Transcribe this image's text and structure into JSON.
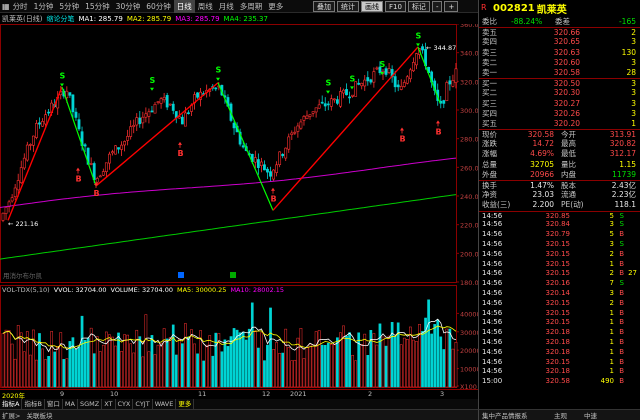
{
  "toolbar": {
    "periods": [
      "分时",
      "1分钟",
      "5分钟",
      "15分钟",
      "30分钟",
      "60分钟",
      "日线",
      "周线",
      "月线",
      "多周期",
      "更多"
    ],
    "active_period": "日线",
    "settings_icon": "gear-icon",
    "right_buttons": [
      "叠加",
      "统计",
      "画线",
      "F10",
      "标记",
      "-",
      "+"
    ],
    "selected_button": "画线"
  },
  "stock": {
    "code": "002821",
    "name": "凯莱英",
    "mark": "R"
  },
  "chart_header": {
    "label": "凯莱英(日线)",
    "fmt": "缩论分笔",
    "ma1": "MA1: 285.79",
    "ma2": "MA2: 285.79",
    "ma3": "MA3: 285.79",
    "ma4": "MA4: 235.37"
  },
  "chart_annotations": {
    "high_label": "344.87",
    "low_label": "221.16",
    "bottom_note": "用消尔布尔凯"
  },
  "y_axis": [
    "360.0",
    "340.0",
    "320.0",
    "300.0",
    "280.0",
    "260.0",
    "240.0",
    "220.0",
    "200.0",
    "180.0"
  ],
  "vol_header": {
    "title": "VOL-TDX(5,10)",
    "vvol": "VVOL: 32704.00",
    "volume": "VOLUME: 32704.00",
    "ma5": "MA5: 30000.25",
    "ma10": "MA10: 28002.15"
  },
  "vol_axis": [
    "40000",
    "30000",
    "20000",
    "10000",
    "X100"
  ],
  "x_axis": [
    "2020年",
    "9",
    "10",
    "11",
    "12",
    "2021",
    "2",
    "3"
  ],
  "index_tabs": [
    "指标A",
    "指标B",
    "窗口",
    "MA",
    "SGMZ",
    "XT",
    "CYX",
    "CYJT",
    "WAVE",
    "更多"
  ],
  "status_bar": {
    "left": "扩展>",
    "mid": "关联板块"
  },
  "right_status": {
    "left": "集中产品情报系",
    "mid": "主观",
    "right": "中速"
  },
  "quote": {
    "wei_bi_label": "委比",
    "wei_bi": "-88.24%",
    "wei_cha_label": "委差",
    "wei_cha": "-165",
    "asks": [
      {
        "label": "卖五",
        "price": "320.66",
        "vol": "2"
      },
      {
        "label": "卖四",
        "price": "320.65",
        "vol": "3"
      },
      {
        "label": "卖三",
        "price": "320.63",
        "vol": "130"
      },
      {
        "label": "卖二",
        "price": "320.60",
        "vol": "3"
      },
      {
        "label": "卖一",
        "price": "320.58",
        "vol": "28"
      }
    ],
    "bids": [
      {
        "label": "买一",
        "price": "320.50",
        "vol": "3"
      },
      {
        "label": "买二",
        "price": "320.30",
        "vol": "3"
      },
      {
        "label": "买三",
        "price": "320.27",
        "vol": "3"
      },
      {
        "label": "买四",
        "price": "320.26",
        "vol": "3"
      },
      {
        "label": "买五",
        "price": "320.20",
        "vol": "1"
      }
    ],
    "stats": [
      {
        "l1": "现价",
        "v1": "320.58",
        "l2": "今开",
        "v2": "313.91"
      },
      {
        "l1": "涨跌",
        "v1": "14.72",
        "l2": "最高",
        "v2": "320.82"
      },
      {
        "l1": "涨幅",
        "v1": "4.69%",
        "l2": "最低",
        "v2": "312.17"
      },
      {
        "l1": "总量",
        "v1": "32705",
        "l2": "量比",
        "v2": "1.15"
      },
      {
        "l1": "外盘",
        "v1": "20966",
        "l2": "内盘",
        "v2": "11739"
      }
    ],
    "stats2": [
      {
        "l1": "换手",
        "v1": "1.47%",
        "l2": "股本",
        "v2": "2.43亿"
      },
      {
        "l1": "净资",
        "v1": "23.03",
        "l2": "流通",
        "v2": "2.23亿"
      },
      {
        "l1": "收益(三)",
        "v1": "2.200",
        "l2": "PE(动)",
        "v2": "118.1"
      }
    ],
    "ticks": [
      {
        "time": "14:56",
        "price": "320.85",
        "vol": "5",
        "dir": "S"
      },
      {
        "time": "14:56",
        "price": "320.84",
        "vol": "3",
        "dir": "S"
      },
      {
        "time": "14:56",
        "price": "320.79",
        "vol": "5",
        "dir": "B"
      },
      {
        "time": "14:56",
        "price": "320.15",
        "vol": "3",
        "dir": "S"
      },
      {
        "time": "14:56",
        "price": "320.15",
        "vol": "2",
        "dir": "B"
      },
      {
        "time": "14:56",
        "price": "320.15",
        "vol": "1",
        "dir": "B"
      },
      {
        "time": "14:56",
        "price": "320.15",
        "vol": "2",
        "dir": "B"
      },
      {
        "time": "14:56",
        "price": "320.16",
        "vol": "7",
        "dir": "S"
      },
      {
        "time": "14:56",
        "price": "320.14",
        "vol": "3",
        "dir": "B"
      },
      {
        "time": "14:56",
        "price": "320.15",
        "vol": "2",
        "dir": "B"
      },
      {
        "time": "14:56",
        "price": "320.15",
        "vol": "1",
        "dir": "B"
      },
      {
        "time": "14:56",
        "price": "320.15",
        "vol": "1",
        "dir": "B"
      },
      {
        "time": "14:56",
        "price": "320.18",
        "vol": "1",
        "dir": "B"
      },
      {
        "time": "14:56",
        "price": "320.18",
        "vol": "1",
        "dir": "B"
      },
      {
        "time": "14:56",
        "price": "320.18",
        "vol": "1",
        "dir": "B"
      },
      {
        "time": "14:56",
        "price": "320.15",
        "vol": "1",
        "dir": "B"
      },
      {
        "time": "14:56",
        "price": "320.18",
        "vol": "1",
        "dir": "B"
      },
      {
        "time": "15:00",
        "price": "320.58",
        "vol": "490",
        "dir": "B"
      }
    ],
    "tick_extra": "27"
  },
  "chart_data": {
    "type": "candlestick",
    "ylim": [
      180,
      360
    ],
    "candles_count": 150,
    "signals": [
      {
        "type": "S",
        "price": 329.0
      },
      {
        "type": "B",
        "price": 246.0
      },
      {
        "type": "S",
        "price": 322.0
      },
      {
        "type": "B",
        "price": 270.0
      },
      {
        "type": "S",
        "price": 327.0
      },
      {
        "type": "B",
        "price": 241.0
      },
      {
        "type": "S",
        "price": 344.87
      },
      {
        "type": "B",
        "price": 278.0
      },
      {
        "type": "B",
        "price": 280.0
      }
    ]
  },
  "colors": {
    "up": "#ff3030",
    "down": "#00d4d4",
    "ma_purple": "#cc00cc",
    "ma_green": "#00cc00",
    "trend": "#ff0000",
    "seg": "#00ff00",
    "sell": "#00ff00",
    "buy": "#ff3030"
  }
}
